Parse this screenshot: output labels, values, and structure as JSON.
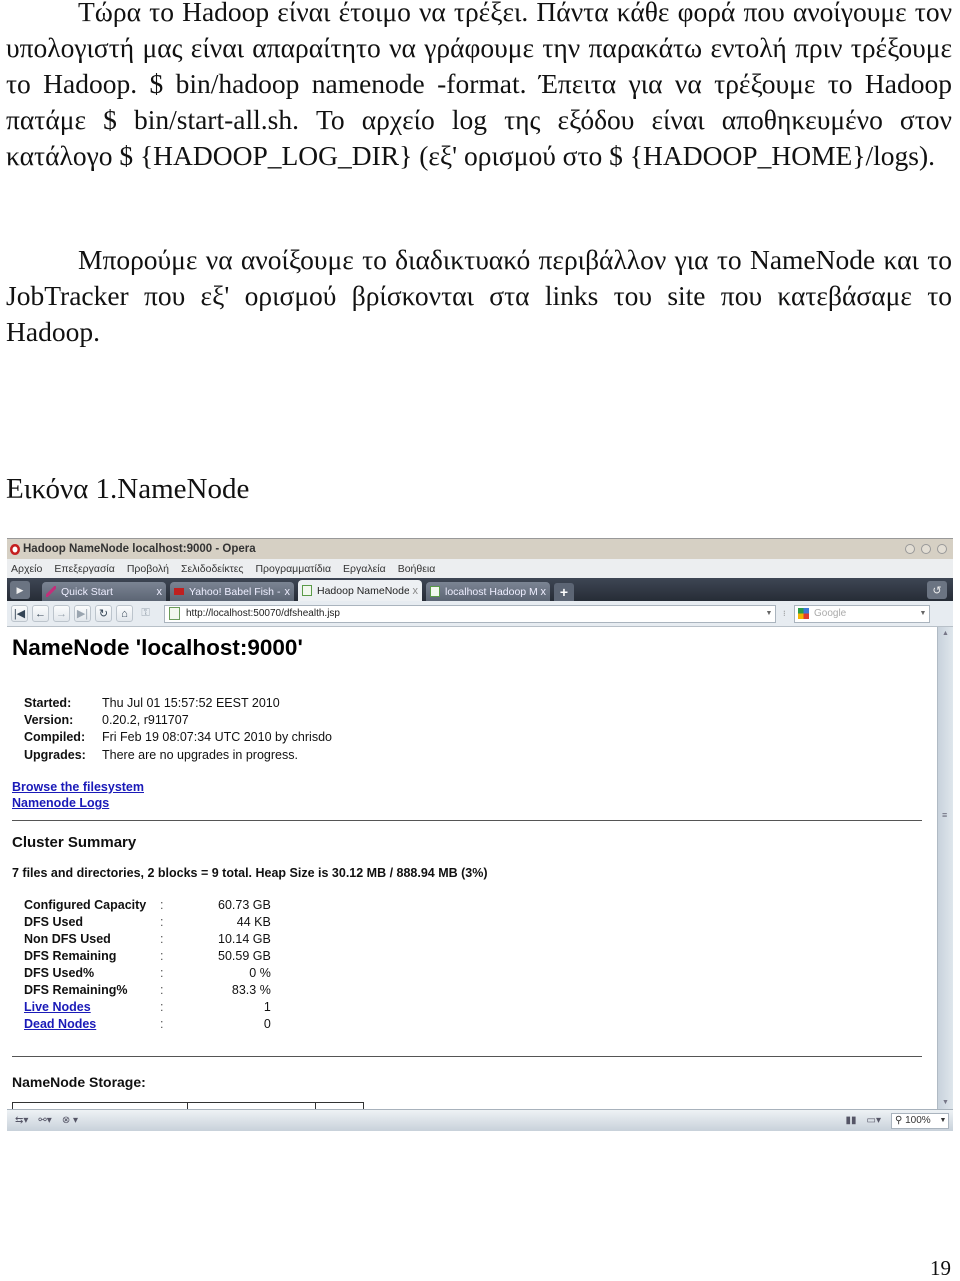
{
  "document": {
    "paragraph1": "Τώρα το Hadoop είναι έτοιμο να τρέξει. Πάντα κάθε φορά που ανοίγουμε τον υπολογιστή μας είναι απαραίτητο να γράφουμε την παρακάτω εντολή πριν τρέξουμε το Hadoop. $ bin/hadoop namenode -format.  Έπειτα για να τρέξουμε το Hadoop πατάμε $ bin/start-all.sh. Το αρχείο log της εξόδου είναι αποθηκευμένο στον κατάλογο $ {HADOOP_LOG_DIR} (εξ' ορισμού στο $ {HADOOP_HOME}/logs).",
    "paragraph2": "Μπορούμε να ανοίξουμε το διαδικτυακό περιβάλλον για το NameNode και το JobTracker που εξ' ορισμού βρίσκονται στα links του site που κατεβάσαμε το Hadoop.",
    "figure_caption": "Εικόνα 1.NameNode",
    "page_number": "19"
  },
  "browser": {
    "window_title": "Hadoop NameNode localhost:9000 - Opera",
    "menu": [
      "Αρχείο",
      "Επεξεργασία",
      "Προβολή",
      "Σελιδοδείκτες",
      "Προγραμματίδια",
      "Εργαλεία",
      "Βοήθεια"
    ],
    "tabs": [
      {
        "label": "Quick Start",
        "close": "x",
        "icon": "quill-icon",
        "color": "#b0307a"
      },
      {
        "label": "Yahoo! Babel Fish - T...",
        "close": "x",
        "icon": "yahoo-icon",
        "color": "#c02020"
      },
      {
        "label": "Hadoop NameNode l...",
        "close": "x",
        "icon": "page-icon",
        "color": "#5a9a48"
      },
      {
        "label": "localhost Hadoop Ma...",
        "close": "x",
        "icon": "page-icon",
        "color": "#5a9a48"
      }
    ],
    "active_tab": 2,
    "new_tab": "+",
    "url": "http://localhost:50070/dfshealth.jsp",
    "search_placeholder": "Google",
    "zoom_level": "100%"
  },
  "page": {
    "title": "NameNode 'localhost:9000'",
    "info": [
      {
        "key": "Started:",
        "value": "Thu Jul 01 15:57:52 EEST 2010"
      },
      {
        "key": "Version:",
        "value": "0.20.2, r911707"
      },
      {
        "key": "Compiled:",
        "value": "Fri Feb 19 08:07:34 UTC 2010 by chrisdo"
      },
      {
        "key": "Upgrades:",
        "value": "There are no upgrades in progress."
      }
    ],
    "links": [
      "Browse the filesystem",
      "Namenode Logs"
    ],
    "cluster_summary_title": "Cluster Summary",
    "cluster_summary_line": "7 files and directories, 2 blocks = 9 total. Heap Size is 30.12 MB / 888.94 MB (3%)",
    "summary": [
      {
        "key": "Configured Capacity",
        "sep": ":",
        "value": "60.73 GB",
        "link": false
      },
      {
        "key": "DFS Used",
        "sep": ":",
        "value": "44 KB",
        "link": false
      },
      {
        "key": "Non DFS Used",
        "sep": ":",
        "value": "10.14 GB",
        "link": false
      },
      {
        "key": "DFS Remaining",
        "sep": ":",
        "value": "50.59 GB",
        "link": false
      },
      {
        "key": "DFS Used%",
        "sep": ":",
        "value": "0 %",
        "link": false
      },
      {
        "key": "DFS Remaining%",
        "sep": ":",
        "value": "83.3 %",
        "link": false
      },
      {
        "key": "Live Nodes",
        "sep": ":",
        "value": "1",
        "link": true
      },
      {
        "key": "Dead Nodes",
        "sep": ":",
        "value": "0",
        "link": true
      }
    ],
    "storage_title": "NameNode Storage:"
  }
}
